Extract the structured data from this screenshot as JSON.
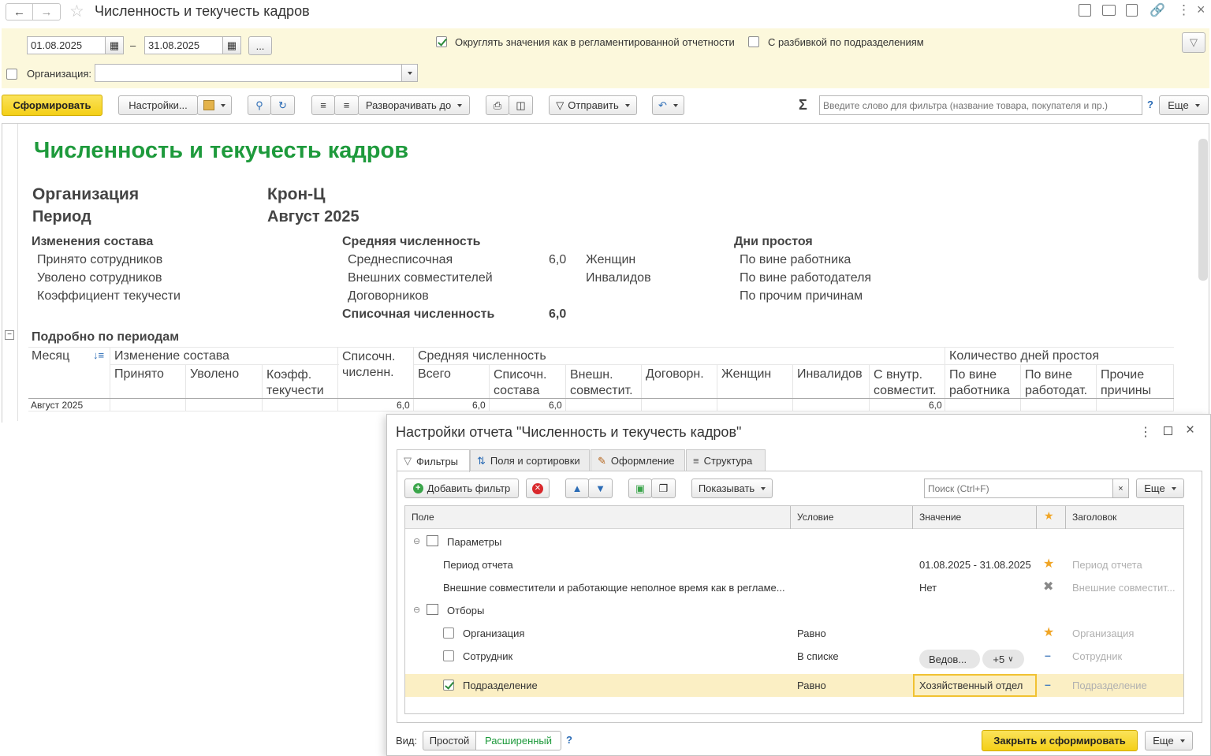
{
  "window": {
    "title": "Численность и текучесть кадров"
  },
  "params": {
    "date_from": "01.08.2025",
    "date_to": "31.08.2025",
    "dash": "–",
    "more": "...",
    "round_label": "Округлять значения как в регламентированной отчетности",
    "split_label": "С разбивкой по подразделениям",
    "org_label": "Организация:",
    "org_value": ""
  },
  "toolbar": {
    "generate": "Сформировать",
    "settings": "Настройки...",
    "expand": "Разворачивать до",
    "send": "Отправить",
    "sigma": "Σ",
    "filter_placeholder": "Введите слово для фильтра (название товара, покупателя и пр.)",
    "help": "?",
    "more": "Еще"
  },
  "report": {
    "title": "Численность и текучесть кадров",
    "org_label": "Организация",
    "org_value": "Крон-Ц",
    "period_label": "Период",
    "period_value": "Август 2025",
    "changes_title": "Изменения состава",
    "changes": [
      "Принято сотрудников",
      "Уволено сотрудников",
      "Коэффициент текучести"
    ],
    "avg_title": "Средняя численность",
    "avg": [
      "Среднесписочная",
      "Внешних совместителей",
      "Договорников"
    ],
    "avg_value": "6,0",
    "women": "Женщин",
    "disabled": "Инвалидов",
    "list_label": "Списочная численность",
    "list_value": "6,0",
    "idle_title": "Дни простоя",
    "idle": [
      "По вине работника",
      "По вине работодателя",
      "По прочим причинам"
    ],
    "detail_title": "Подробно по периодам",
    "h_month": "Месяц",
    "h_change": "Изменение состава",
    "h_accepted": "Принято",
    "h_fired": "Уволено",
    "h_coeff": "Коэфф. текучести",
    "h_listnum": "Списочн. численн.",
    "h_avg": "Средняя численность",
    "h_total": "Всего",
    "h_listc": "Списочн. состава",
    "h_ext": "Внешн. совместит.",
    "h_dog": "Договорн.",
    "h_women": "Женщин",
    "h_inv": "Инвалидов",
    "h_inner": "С внутр. совместит.",
    "h_idle": "Количество дней простоя",
    "h_worker": "По вине работника",
    "h_employer": "По вине работодат.",
    "h_other": "Прочие причины",
    "row_month": "Август 2025",
    "row_v1": "6,0",
    "row_v2": "6,0",
    "row_v3": "6,0",
    "row_v4": "6,0"
  },
  "dialog": {
    "title": "Настройки отчета \"Численность и текучесть кадров\"",
    "tabs": [
      "Фильтры",
      "Поля и сортировки",
      "Оформление",
      "Структура"
    ],
    "add_filter": "Добавить фильтр",
    "show": "Показывать",
    "search_placeholder": "Поиск (Ctrl+F)",
    "more": "Еще",
    "cols": {
      "field": "Поле",
      "cond": "Условие",
      "value": "Значение",
      "header": "Заголовок"
    },
    "rows": {
      "params": "Параметры",
      "period": "Период отчета",
      "period_value": "01.08.2025 - 31.08.2025",
      "period_header": "Период отчета",
      "ext": "Внешние совместители и работающие неполное время как в регламе...",
      "ext_value": "Нет",
      "ext_header": "Внешние совместит...",
      "filters": "Отборы",
      "org": "Организация",
      "org_cond": "Равно",
      "org_header": "Организация",
      "emp": "Сотрудник",
      "emp_cond": "В списке",
      "emp_chip": "Ведов...",
      "emp_more": "+5",
      "emp_header": "Сотрудник",
      "dep": "Подразделение",
      "dep_cond": "Равно",
      "dep_value": "Хозяйственный отдел",
      "dep_header": "Подразделение"
    },
    "view_label": "Вид:",
    "view_simple": "Простой",
    "view_ext": "Расширенный",
    "help": "?",
    "close_generate": "Закрыть и сформировать",
    "more2": "Еще"
  },
  "colors": {
    "accent_yellow": "#f9d835",
    "green_title": "#1e9a3c",
    "panel_bg": "#fcf8dc",
    "selected_row": "#fbefc4"
  }
}
